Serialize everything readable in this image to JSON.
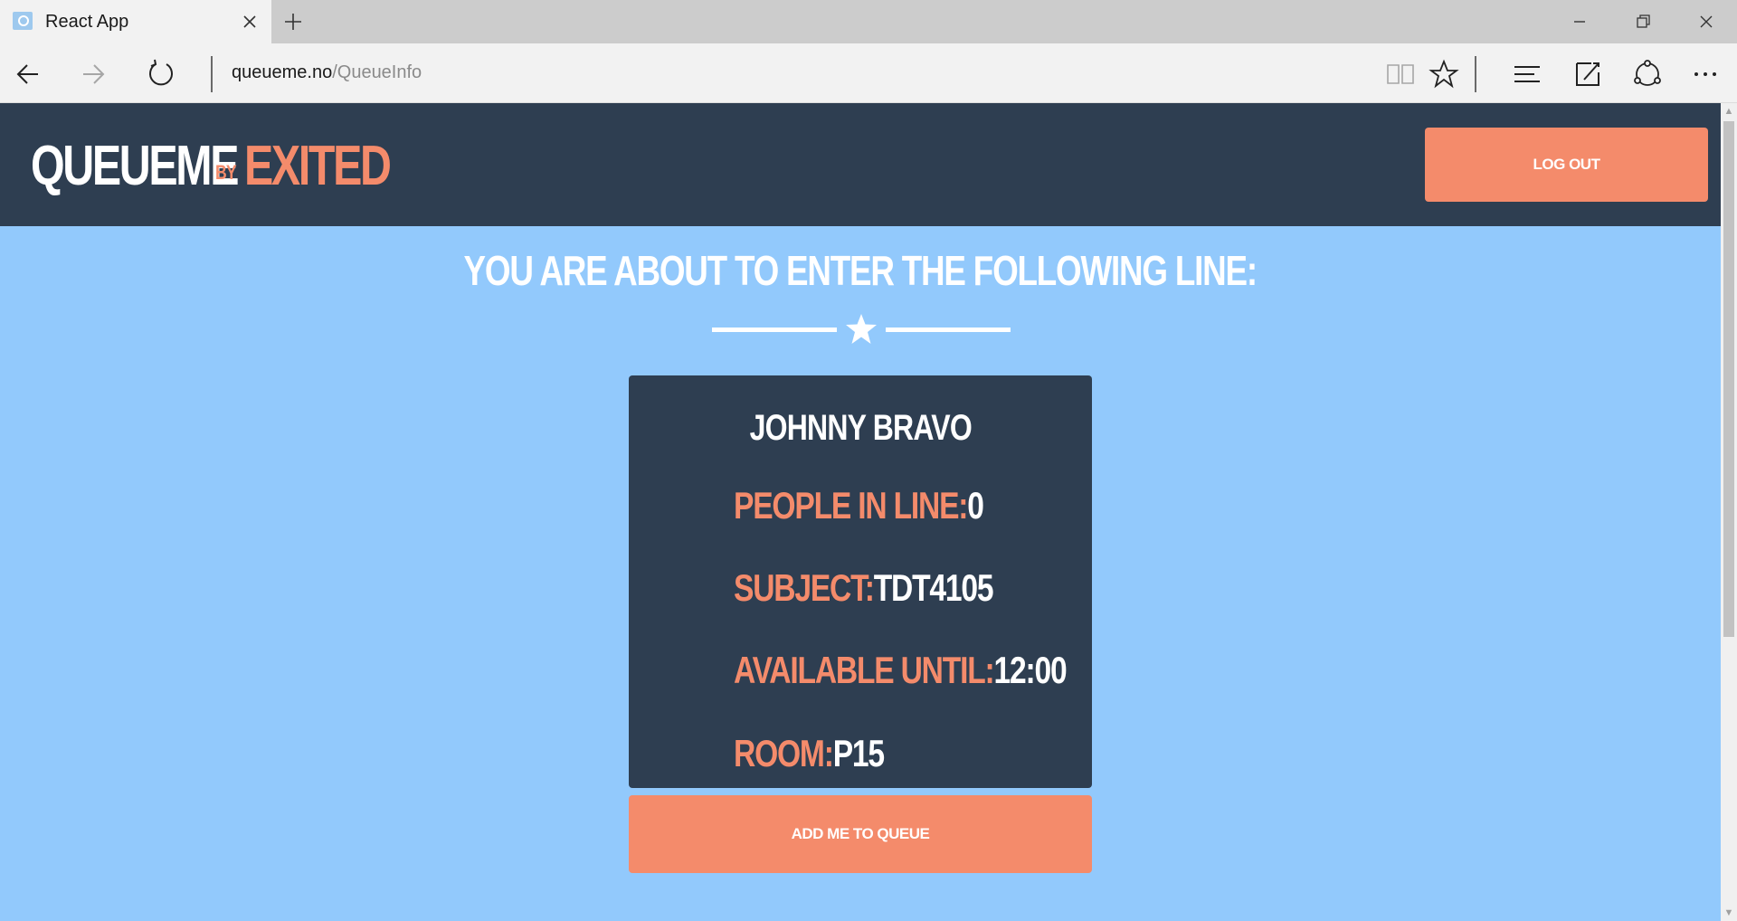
{
  "browser": {
    "tab_title": "React App",
    "url_domain": "queueme.no",
    "url_path": "/QueueInfo"
  },
  "header": {
    "logo_main": "QUEUEME",
    "logo_by": "BY",
    "logo_brand": "EXITED",
    "logout_label": "LOG OUT"
  },
  "main": {
    "heading": "YOU ARE ABOUT TO ENTER THE FOLLOWING LINE:",
    "card": {
      "title": "JOHNNY BRAVO",
      "rows": [
        {
          "label": "PEOPLE IN LINE:",
          "value": "0"
        },
        {
          "label": "SUBJECT:",
          "value": "TDT4105"
        },
        {
          "label": "AVAILABLE UNTIL:",
          "value": "12:00"
        },
        {
          "label": "ROOM:",
          "value": "P15"
        }
      ]
    },
    "add_button_label": "ADD ME TO QUEUE"
  },
  "colors": {
    "header_bg": "#2e3e51",
    "page_bg": "#92c9fc",
    "accent": "#f48b6b"
  },
  "icons": {
    "divider": "star-icon"
  }
}
